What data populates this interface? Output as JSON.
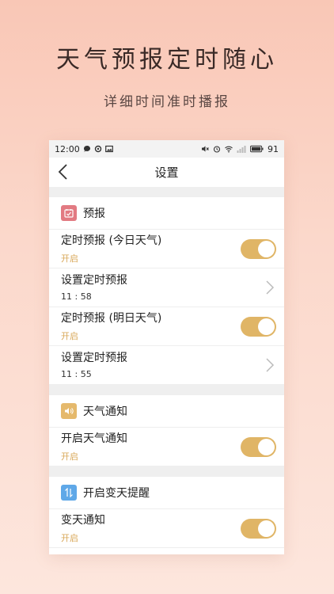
{
  "headline": "天气预报定时随心",
  "subline": "详细时间准时播报",
  "status": {
    "time": "12:00",
    "battery": "91"
  },
  "titlebar": {
    "title": "设置"
  },
  "sections": [
    {
      "title": "预报",
      "icon": "calendar-icon",
      "color": "#e27a82"
    },
    {
      "title": "天气通知",
      "icon": "speaker-icon",
      "color": "#e5b96c"
    },
    {
      "title": "开启变天提醒",
      "icon": "swap-arrows-icon",
      "color": "#5fa8e8"
    }
  ],
  "rows": [
    {
      "label": "定时预报 (今日天气)",
      "sub": "开启",
      "type": "toggle",
      "on": true
    },
    {
      "label": "设置定时预报",
      "sub": "11 : 58",
      "type": "link"
    },
    {
      "label": "定时预报 (明日天气)",
      "sub": "开启",
      "type": "toggle",
      "on": true
    },
    {
      "label": "设置定时预报",
      "sub": "11 : 55",
      "type": "link"
    },
    {
      "label": "开启天气通知",
      "sub": "开启",
      "type": "toggle",
      "on": true
    },
    {
      "label": "变天通知",
      "sub": "开启",
      "type": "toggle",
      "on": true
    }
  ],
  "colors": {
    "accent": "#e0b566",
    "bg_top": "#f9c7b6"
  }
}
